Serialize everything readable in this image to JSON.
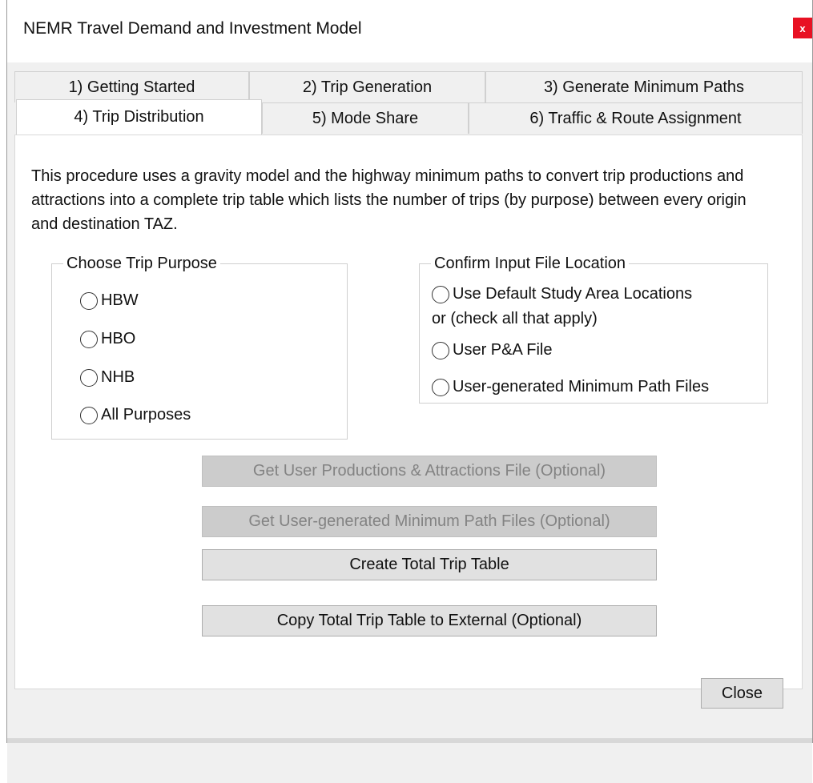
{
  "window": {
    "title": "NEMR Travel Demand and Investment Model",
    "close_glyph": "x"
  },
  "tabs": [
    {
      "label": "1) Getting Started"
    },
    {
      "label": "2) Trip Generation"
    },
    {
      "label": "3) Generate Minimum Paths"
    },
    {
      "label": "4) Trip Distribution"
    },
    {
      "label": "5) Mode Share"
    },
    {
      "label": "6) Traffic & Route Assignment"
    }
  ],
  "panel": {
    "description": "This procedure uses a gravity model and the highway minimum paths to convert trip productions and attractions into a complete trip table which lists the number of trips (by purpose) between every origin and destination TAZ.",
    "trip_purpose": {
      "legend": "Choose Trip Purpose",
      "options": [
        "HBW",
        "HBO",
        "NHB",
        "All Purposes"
      ]
    },
    "input_location": {
      "legend": "Confirm Input File Location",
      "default_option": "Use Default Study Area Locations",
      "note": "or (check all that apply)",
      "user_pa": "User P&A File",
      "user_minpath": "User-generated Minimum Path Files"
    },
    "buttons": {
      "get_pa": "Get User Productions & Attractions File (Optional)",
      "get_minpath": "Get User-generated Minimum Path Files (Optional)",
      "create_table": "Create Total Trip Table",
      "copy_table": "Copy Total Trip Table to External (Optional)"
    }
  },
  "footer": {
    "close_label": "Close"
  },
  "colors": {
    "close_red": "#e81123",
    "disabled_button": "#cccccc",
    "button_face": "#e1e1e1"
  }
}
